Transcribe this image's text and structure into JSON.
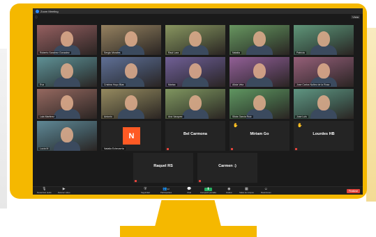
{
  "window": {
    "title": "Zoom Meeting",
    "view_label": "Vista"
  },
  "top_info": "",
  "tiles": [
    {
      "type": "video",
      "name": "Roberto Sanchez Gonzalez"
    },
    {
      "type": "video",
      "name": "Sergio Morales"
    },
    {
      "type": "video",
      "name": "Raul Lara"
    },
    {
      "type": "video",
      "name": "Natalia"
    },
    {
      "type": "video",
      "name": "Patricia"
    },
    {
      "type": "video",
      "name": "Eva"
    },
    {
      "type": "video",
      "name": "Cristina Hoyo Blas"
    },
    {
      "type": "video",
      "name": "Marisa"
    },
    {
      "type": "video",
      "name": "Alicia Vela"
    },
    {
      "type": "video",
      "name": "Jose Carlos Nuñez de la Rosa"
    },
    {
      "type": "video",
      "name": "Laia Martinez"
    },
    {
      "type": "video",
      "name": "Antonio"
    },
    {
      "type": "video",
      "name": "Ana Vazquez"
    },
    {
      "type": "video",
      "name": "Silvia Garcia Ruiz"
    },
    {
      "type": "video",
      "name": "Jose Luis"
    },
    {
      "type": "video",
      "name": "Lucía M"
    },
    {
      "type": "avatar",
      "name": "Natalia Echevarría",
      "initial": "N"
    },
    {
      "type": "named",
      "name": "Bel Carmona"
    },
    {
      "type": "named",
      "name": "Miriam Go",
      "hand": true
    },
    {
      "type": "named",
      "name": "Lourdes HB",
      "hand": true
    },
    {
      "type": "named",
      "name": "Raquel RS"
    },
    {
      "type": "named",
      "name": "Carmen :)"
    }
  ],
  "toolbar": {
    "unmute": "Desactivar audio",
    "video": "Detener video",
    "security": "Seguridad",
    "participants": "Participantes",
    "participants_count": "22",
    "chat": "Chat",
    "share": "Compartir pantalla",
    "record": "Grabar",
    "breakout": "Salas de Grupos",
    "reactions": "Reacciones",
    "end": "Finalizar"
  },
  "icons": {
    "mic": "mic-icon",
    "video": "video-camera-icon",
    "security": "shield-icon",
    "participants": "people-icon",
    "chat": "chat-icon",
    "share": "share-screen-icon",
    "record": "record-icon",
    "breakout": "breakout-rooms-icon",
    "reactions": "smiley-icon",
    "hand": "raised-hand-icon"
  },
  "colors": {
    "frame": "#f5b800",
    "screen": "#1a1a1a",
    "end": "#e0433b",
    "share": "#27ae60",
    "avatar": "#ff5a24"
  }
}
